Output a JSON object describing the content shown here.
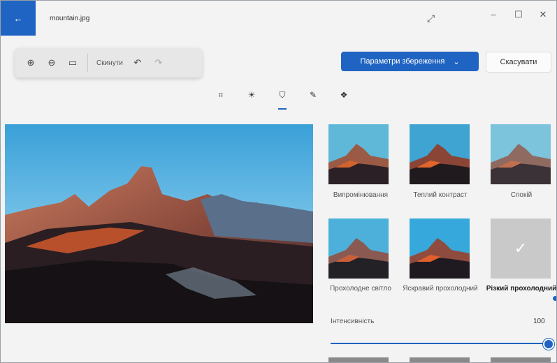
{
  "window": {
    "title": "mountain.jpg",
    "back_icon": "←",
    "expand_icon": "⤢",
    "minimize_icon": "–",
    "maximize_icon": "☐",
    "close_icon": "✕"
  },
  "toolbar": {
    "zoom_in_icon": "⊕",
    "zoom_out_icon": "⊖",
    "fit_icon": "▭",
    "reset_label": "Скинути",
    "undo_icon": "↶",
    "redo_icon": "↷"
  },
  "actions": {
    "save_label": "Параметри збереження",
    "save_chevron": "⌄",
    "cancel_label": "Скасувати"
  },
  "tools": [
    {
      "name": "crop",
      "icon": "⌗"
    },
    {
      "name": "adjust",
      "icon": "☀"
    },
    {
      "name": "filters",
      "icon": "⛉"
    },
    {
      "name": "markup",
      "icon": "✎"
    },
    {
      "name": "more",
      "icon": "❖"
    }
  ],
  "filters": [
    {
      "label": "Випромінювання"
    },
    {
      "label": "Теплий контраст"
    },
    {
      "label": "Спокій"
    },
    {
      "label": "Прохолодне світло"
    },
    {
      "label": "Яскравий прохолодний"
    },
    {
      "label": "Різкий прохолодний",
      "selected_mark": "✓"
    }
  ],
  "intensity": {
    "label": "Інтенсивність",
    "value": "100",
    "fraction": 1.0
  },
  "colors": {
    "accent": "#1f64c2"
  }
}
